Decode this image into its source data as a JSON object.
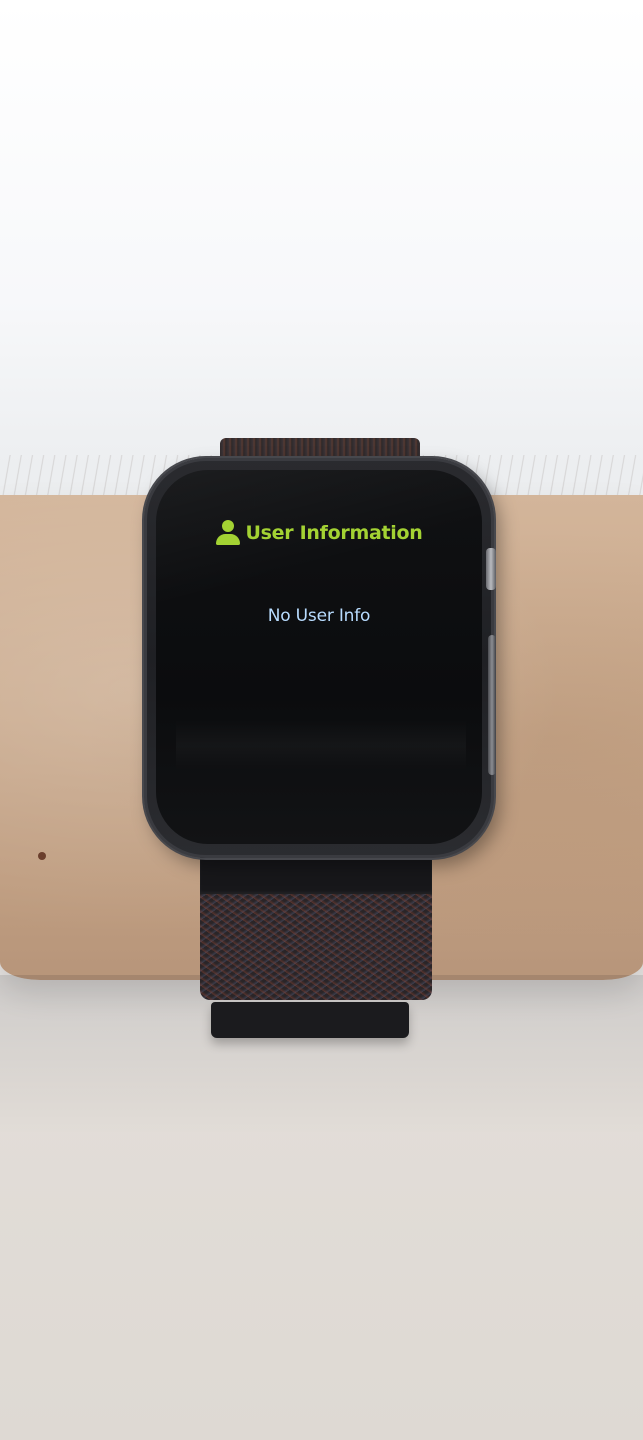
{
  "screen": {
    "title": "User Information",
    "title_icon": "user-icon",
    "message": "No User Info"
  },
  "colors": {
    "accent": "#a3d233",
    "message_text": "#b8dcff",
    "screen_background": "#0d0e10"
  }
}
